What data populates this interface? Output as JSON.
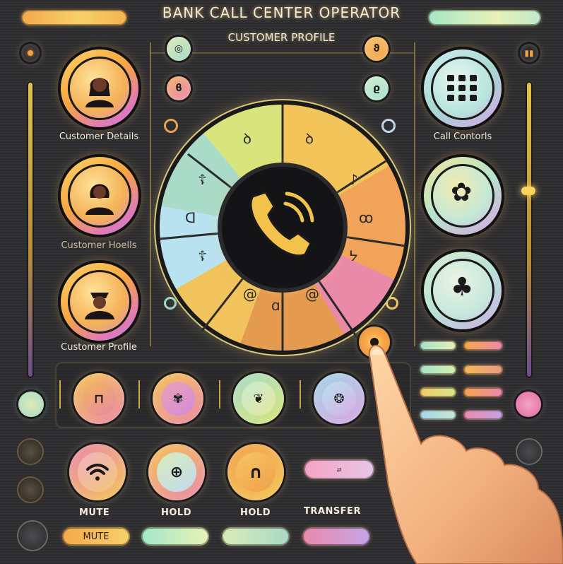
{
  "header": {
    "title": "BANK CALL CENTER OPERATOR",
    "subtitle": "CUSTOMER PROFILE",
    "left_pill": {
      "left_text": "",
      "right_text": "",
      "colors": [
        "#f2a94b",
        "#f7d06a"
      ]
    },
    "right_pill": {
      "left_text": "",
      "right_text": "",
      "colors": [
        "#a4e7c6",
        "#e8f2b8"
      ]
    }
  },
  "left_column": {
    "items": [
      {
        "label": "Customer Details",
        "icon": "female-avatar-icon"
      },
      {
        "label": "Customer Hoells",
        "icon": "woman-avatar-icon"
      },
      {
        "label": "Customer Profile",
        "icon": "profile-avatar-icon"
      }
    ]
  },
  "right_column": {
    "items": [
      {
        "label": "Call Contorls",
        "icon": "keypad-icon"
      },
      {
        "label": "",
        "icon": "flower-icon"
      },
      {
        "label": "",
        "icon": "clover-icon"
      }
    ]
  },
  "dial": {
    "center_icon": "phone-call-icon",
    "segment_icons": [
      "swirl-icon",
      "swirl-icon",
      "arrow-icon",
      "signal-icon",
      "anchor-icon",
      "spiral-icon",
      "spiral-icon",
      "hook-icon"
    ]
  },
  "middle_row": {
    "buttons": [
      "speaker-icon",
      "flower-icon",
      "swirl-icon",
      "refresh-icon"
    ]
  },
  "side_mini_pills": [
    {
      "left": "",
      "right": ""
    },
    {
      "left": "",
      "right": ""
    },
    {
      "left": "",
      "right": ""
    },
    {
      "left": "",
      "right": ""
    }
  ],
  "bottom": {
    "buttons": [
      {
        "label": "MUTE",
        "icon": "wifi-icon",
        "pill_text": "MUTE"
      },
      {
        "label": "HOLD",
        "icon": "headset-icon",
        "pill_text": ""
      },
      {
        "label": "HOLD",
        "icon": "pause-icon",
        "pill_text": ""
      },
      {
        "label": "TRANSFER",
        "icon": "transfer-icon",
        "pill_text": ""
      }
    ]
  },
  "colors": {
    "gold": "#f3c45a",
    "pink": "#e98aa9",
    "mint": "#a9dbc8",
    "panel": "#2c2c2e"
  }
}
